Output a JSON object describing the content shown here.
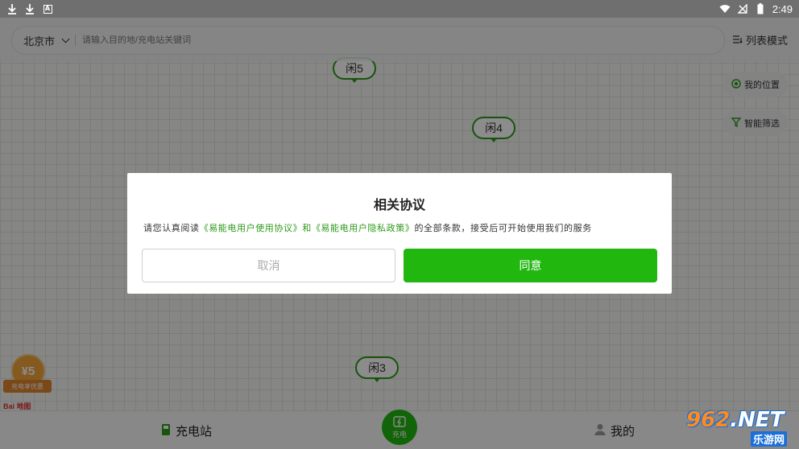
{
  "statusbar": {
    "time": "2:49"
  },
  "search": {
    "city": "北京市",
    "placeholder": "请输入目的地/充电站关键词",
    "list_mode": "列表模式"
  },
  "side": {
    "my_location": "我的位置",
    "smart_filter": "智能筛选"
  },
  "markers": [
    {
      "label": "闲5"
    },
    {
      "label": "闲4"
    },
    {
      "label": "闲3"
    }
  ],
  "dialog": {
    "title": "相关协议",
    "text_prefix": "请您认真阅读",
    "link_user": "《易能电用户使用协议》",
    "text_and": "和",
    "link_privacy": "《易能电用户隐私政策》",
    "text_suffix": "的全部条款，接受后可开始使用我们的服务",
    "cancel": "取消",
    "agree": "同意"
  },
  "bottomnav": {
    "stations": "充电站",
    "charge": "充电",
    "mine": "我的"
  },
  "promo": {
    "amount": "¥5",
    "ribbon": "充电享优惠",
    "baidu": "Bai 地图"
  },
  "watermark": {
    "top_num": "962",
    "top_suffix": ".NET",
    "bottom": "乐游网"
  },
  "colors": {
    "brand_green": "#21b70f",
    "link_green": "#2b9a17"
  }
}
